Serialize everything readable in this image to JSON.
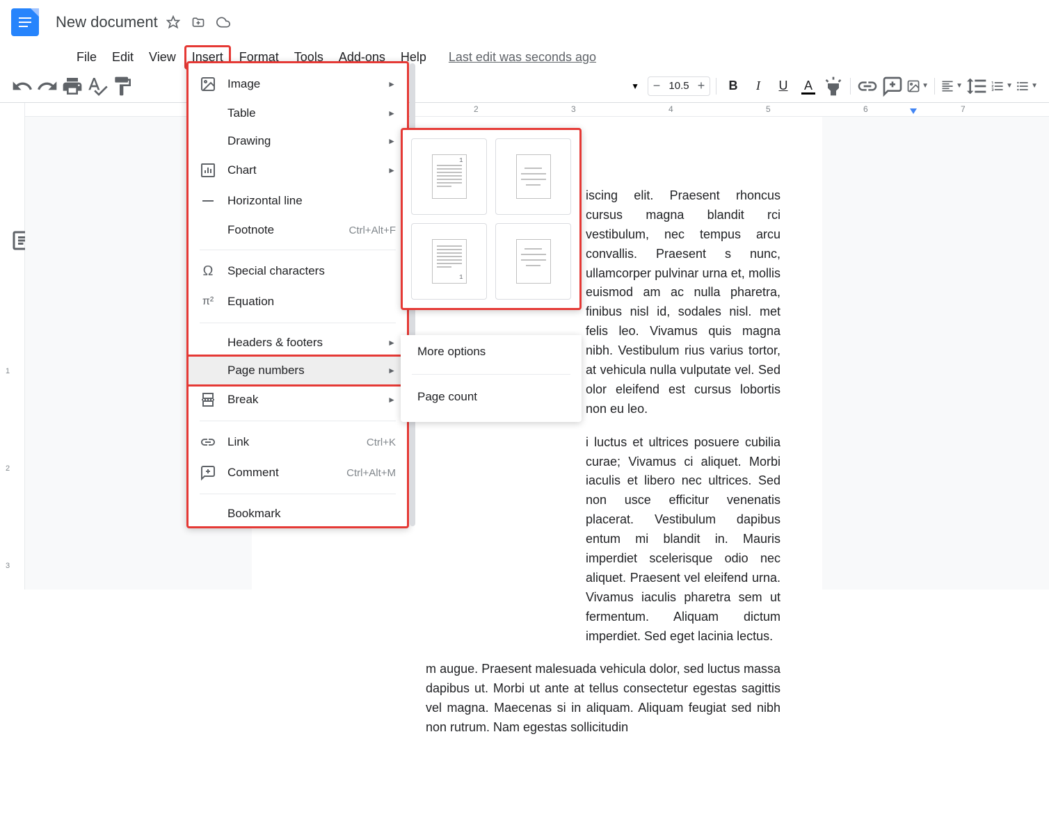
{
  "doc_title": "New document",
  "menubar": {
    "file": "File",
    "edit": "Edit",
    "view": "View",
    "insert": "Insert",
    "format": "Format",
    "tools": "Tools",
    "addons": "Add-ons",
    "help": "Help"
  },
  "last_edit": "Last edit was seconds ago",
  "toolbar": {
    "font_size": "10.5"
  },
  "insert_menu": {
    "image": "Image",
    "table": "Table",
    "drawing": "Drawing",
    "chart": "Chart",
    "horizontal_line": "Horizontal line",
    "footnote": "Footnote",
    "footnote_shortcut": "Ctrl+Alt+F",
    "special_chars": "Special characters",
    "equation": "Equation",
    "headers_footers": "Headers & footers",
    "page_numbers": "Page numbers",
    "break": "Break",
    "link": "Link",
    "link_shortcut": "Ctrl+K",
    "comment": "Comment",
    "comment_shortcut": "Ctrl+Alt+M",
    "bookmark": "Bookmark"
  },
  "page_num_submenu": {
    "more_options": "More options",
    "page_count": "Page count"
  },
  "ruler": {
    "nums": [
      "2",
      "3",
      "4",
      "5",
      "6",
      "7"
    ]
  },
  "left_ruler": [
    "1",
    "2",
    "3"
  ],
  "doc_body": {
    "p1": "iscing elit. Praesent rhoncus cursus magna blandit rci vestibulum, nec tempus arcu convallis. Praesent s nunc, ullamcorper pulvinar urna et, mollis euismod am ac nulla pharetra, finibus nisl id, sodales nisl. met felis leo. Vivamus quis magna nibh. Vestibulum rius varius tortor, at vehicula nulla vulputate vel. Sed olor eleifend est cursus lobortis non eu leo.",
    "p2": "i luctus et ultrices posuere cubilia curae; Vivamus ci aliquet. Morbi iaculis et libero nec ultrices. Sed non usce efficitur venenatis placerat. Vestibulum dapibus entum mi blandit in. Mauris imperdiet scelerisque odio nec aliquet. Praesent vel eleifend urna. Vivamus iaculis pharetra sem ut fermentum. Aliquam dictum imperdiet. Sed eget lacinia lectus.",
    "p3": "m augue. Praesent malesuada vehicula dolor, sed luctus massa dapibus ut. Morbi ut ante at tellus consectetur egestas sagittis vel magna. Maecenas si in aliquam. Aliquam feugiat sed nibh non rutrum. Nam egestas sollicitudin"
  }
}
